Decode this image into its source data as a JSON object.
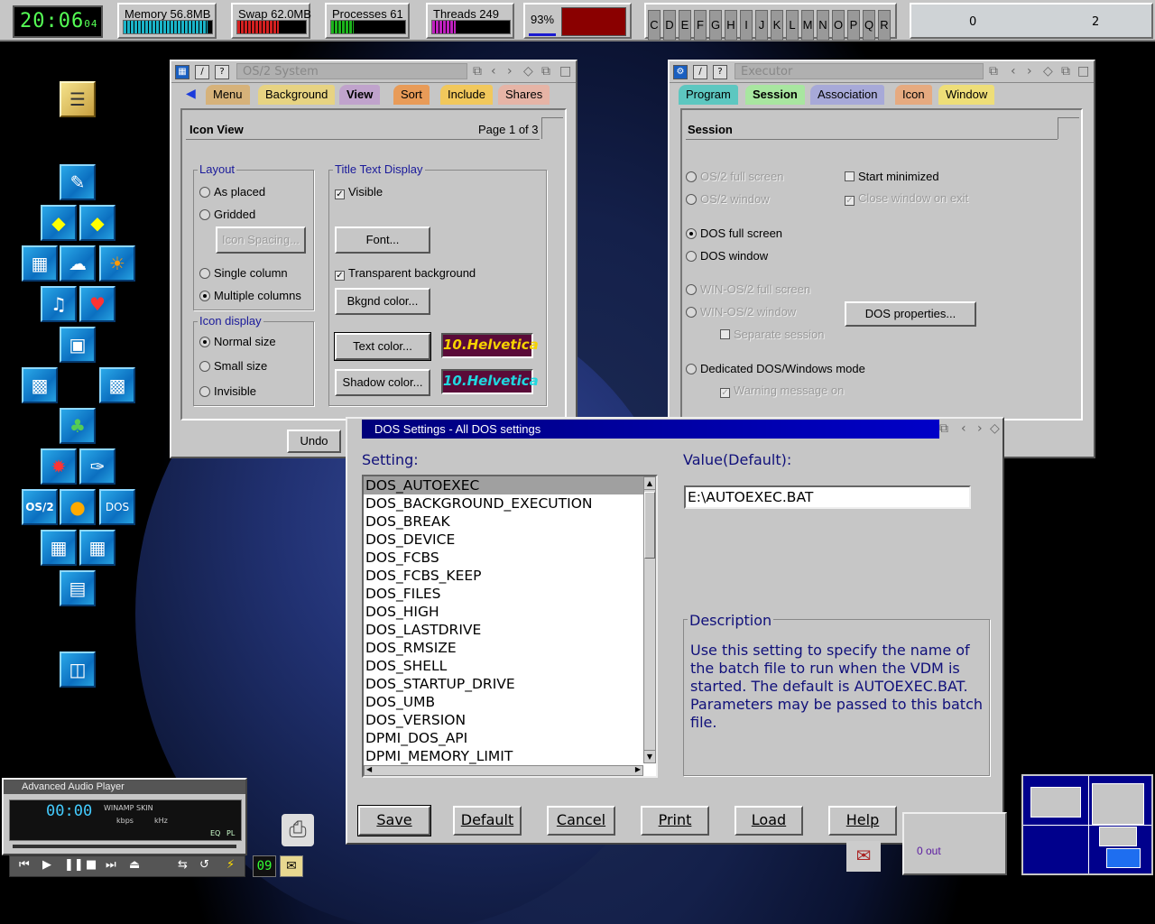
{
  "topbar": {
    "clock": "20:06",
    "clock_seconds": "04",
    "memory": {
      "label": "Memory 56.8MB",
      "level": 0.95,
      "color": "#1ab4c8"
    },
    "swap": {
      "label": "Swap 62.0MB",
      "level": 0.6,
      "color": "#d42020"
    },
    "processes": {
      "label": "Processes 61",
      "level": 0.3,
      "color": "#1cb41c"
    },
    "threads": {
      "label": "Threads 249",
      "level": 0.3,
      "color": "#c020c0"
    },
    "cpu_percent": "93%",
    "drives": [
      "C",
      "D",
      "E",
      "F",
      "G",
      "H",
      "I",
      "J",
      "K",
      "L",
      "M",
      "N",
      "O",
      "P",
      "Q",
      "R"
    ],
    "desk_left": "0",
    "desk_right": "2"
  },
  "os2_window": {
    "title": "OS/2 System",
    "tabs": [
      "Menu",
      "Background",
      "View",
      "Sort",
      "Include",
      "Shares"
    ],
    "active_tab": "View",
    "page_title": "Icon View",
    "page_indicator": "Page 1 of 3",
    "layout": {
      "label": "Layout",
      "as_placed": "As placed",
      "gridded": "Gridded",
      "icon_spacing": "Icon Spacing...",
      "single_column": "Single column",
      "multiple_columns": "Multiple columns"
    },
    "icon_display": {
      "label": "Icon display",
      "normal": "Normal size",
      "small": "Small size",
      "invisible": "Invisible"
    },
    "title_text": {
      "label": "Title Text Display",
      "visible": "Visible",
      "font": "Font...",
      "transparent": "Transparent background",
      "bkgnd_color": "Bkgnd color...",
      "text_color": "Text color...",
      "shadow_color": "Shadow color...",
      "font_sample": "10.Helvetica"
    },
    "undo": "Undo"
  },
  "executor_window": {
    "title": "Executor",
    "tabs": [
      "Program",
      "Session",
      "Association",
      "Icon",
      "Window"
    ],
    "active_tab": "Session",
    "page_title": "Session",
    "os2_full": "OS/2 full screen",
    "os2_window": "OS/2 window",
    "dos_full": "DOS full screen",
    "dos_window": "DOS window",
    "win_full": "WIN-OS/2 full screen",
    "win_window": "WIN-OS/2 window",
    "separate": "Separate session",
    "dedicated": "Dedicated DOS/Windows mode",
    "warning": "Warning message on",
    "start_min": "Start minimized",
    "close_exit": "Close window on exit",
    "dos_props": "DOS properties..."
  },
  "dos_dialog": {
    "title": "DOS Settings - All DOS settings",
    "setting_label": "Setting:",
    "value_label": "Value(Default):",
    "value": "E:\\AUTOEXEC.BAT",
    "settings": [
      "DOS_AUTOEXEC",
      "DOS_BACKGROUND_EXECUTION",
      "DOS_BREAK",
      "DOS_DEVICE",
      "DOS_FCBS",
      "DOS_FCBS_KEEP",
      "DOS_FILES",
      "DOS_HIGH",
      "DOS_LASTDRIVE",
      "DOS_RMSIZE",
      "DOS_SHELL",
      "DOS_STARTUP_DRIVE",
      "DOS_UMB",
      "DOS_VERSION",
      "DPMI_DOS_API",
      "DPMI_MEMORY_LIMIT"
    ],
    "selected": "DOS_AUTOEXEC",
    "description_label": "Description",
    "description": "Use this setting to specify the name of the batch file to run when the VDM is started.  The default is AUTOEXEC.BAT. Parameters may be passed to this batch file.",
    "buttons": [
      "Save",
      "Default",
      "Cancel",
      "Print",
      "Load",
      "Help"
    ]
  },
  "audio_player": {
    "title": "Advanced Audio Player",
    "time": "00:00",
    "skin": "WINAMP SKIN",
    "kbps": "kbps",
    "khz": "kHz",
    "eq": "EQ",
    "pl": "PL",
    "counter": "09"
  },
  "mail_widget": {
    "text": "0 out"
  },
  "colors": {
    "accent_title": "#0000c0",
    "group_label": "#1a1a9a",
    "description_text": "#10107a"
  }
}
